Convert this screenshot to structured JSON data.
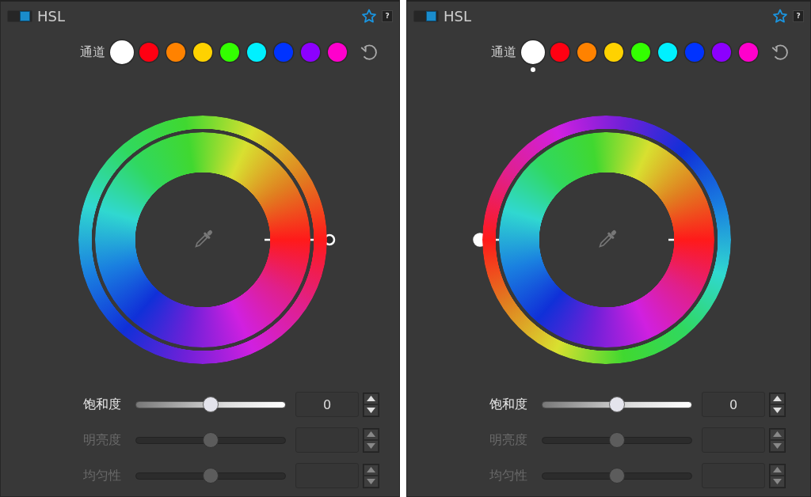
{
  "panels": [
    {
      "title": "HSL",
      "help": "?",
      "enabled": true,
      "channel_label": "通道",
      "channels": [
        {
          "color": "#ffffff",
          "selected": true,
          "modified": false
        },
        {
          "color": "#ff0012",
          "selected": false,
          "modified": false
        },
        {
          "color": "#ff8200",
          "selected": false,
          "modified": false
        },
        {
          "color": "#ffd200",
          "selected": false,
          "modified": false
        },
        {
          "color": "#33ff00",
          "selected": false,
          "modified": false
        },
        {
          "color": "#00f0ff",
          "selected": false,
          "modified": false
        },
        {
          "color": "#0033ff",
          "selected": false,
          "modified": false
        },
        {
          "color": "#8c00ff",
          "selected": false,
          "modified": false
        },
        {
          "color": "#ff00cc",
          "selected": false,
          "modified": false
        }
      ],
      "hue_dial": {
        "rotated": false,
        "active": false
      },
      "sliders": [
        {
          "label": "饱和度",
          "level": 0.5,
          "disabled": false,
          "value": "0"
        },
        {
          "label": "明亮度",
          "level": 0.5,
          "disabled": true
        },
        {
          "label": "均匀性",
          "level": 0.5,
          "disabled": true
        }
      ]
    },
    {
      "title": "HSL",
      "help": "?",
      "enabled": true,
      "channel_label": "通道",
      "channels": [
        {
          "color": "#ffffff",
          "selected": true,
          "modified": true
        },
        {
          "color": "#ff0012",
          "selected": false,
          "modified": false
        },
        {
          "color": "#ff8200",
          "selected": false,
          "modified": false
        },
        {
          "color": "#ffd200",
          "selected": false,
          "modified": false
        },
        {
          "color": "#33ff00",
          "selected": false,
          "modified": false
        },
        {
          "color": "#00f0ff",
          "selected": false,
          "modified": false
        },
        {
          "color": "#0033ff",
          "selected": false,
          "modified": false
        },
        {
          "color": "#8c00ff",
          "selected": false,
          "modified": false
        },
        {
          "color": "#ff00cc",
          "selected": false,
          "modified": false
        }
      ],
      "hue_dial": {
        "rotated": true,
        "active": true
      },
      "sliders": [
        {
          "label": "饱和度",
          "level": 0.5,
          "disabled": false,
          "value": "0"
        },
        {
          "label": "明亮度",
          "level": 0.5,
          "disabled": true
        },
        {
          "label": "均匀性",
          "level": 0.5,
          "disabled": true
        }
      ]
    }
  ]
}
